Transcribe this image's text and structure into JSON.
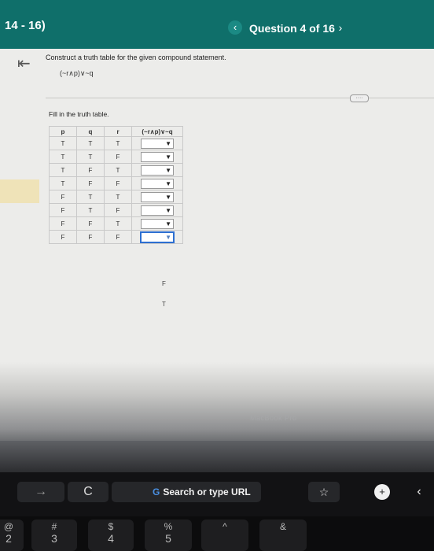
{
  "header": {
    "range_title": "14 - 16)",
    "question_label": "Question 4 of 16",
    "prev_icon": "‹",
    "next_icon": "›"
  },
  "collapse_icon": "⇤",
  "question": {
    "prompt": "Construct a truth table for the given compound statement.",
    "expression": "(~r∧p)∨~q",
    "instruction": "Fill in the truth table.",
    "more_icon": "····"
  },
  "table": {
    "headers": [
      "p",
      "q",
      "r",
      "(~r∧p)∨~q"
    ],
    "rows": [
      [
        "T",
        "T",
        "T"
      ],
      [
        "T",
        "T",
        "F"
      ],
      [
        "T",
        "F",
        "T"
      ],
      [
        "T",
        "F",
        "F"
      ],
      [
        "F",
        "T",
        "T"
      ],
      [
        "F",
        "T",
        "F"
      ],
      [
        "F",
        "F",
        "T"
      ],
      [
        "F",
        "F",
        "F"
      ]
    ],
    "dropdown_arrow": "▼"
  },
  "dropdown_options": [
    "F",
    "T"
  ],
  "brand_text": "MacBook Pro",
  "touchbar": {
    "back_icon": "→",
    "reload_icon": "C",
    "url_placeholder": "Search or type URL",
    "google_icon": "G",
    "star_icon": "☆",
    "plus_icon": "+",
    "chevron_icon": "‹"
  },
  "keyboard": {
    "keys": [
      {
        "top": "@",
        "bottom": "2"
      },
      {
        "top": "#",
        "bottom": "3"
      },
      {
        "top": "$",
        "bottom": "4"
      },
      {
        "top": "%",
        "bottom": "5"
      },
      {
        "top": "^",
        "bottom": ""
      },
      {
        "top": "&",
        "bottom": ""
      }
    ]
  }
}
